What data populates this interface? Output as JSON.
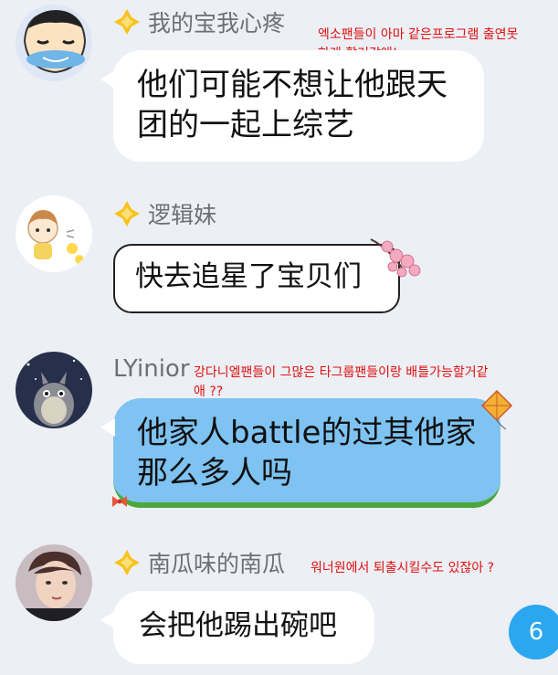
{
  "messages": [
    {
      "name": "我的宝我心疼",
      "text_line1": "他们可能不想让他跟天",
      "text_line2": "团的一起上综艺",
      "annotation_line1": "엑소팬들이 아마 같은프로그램 출연못",
      "annotation_line2": "하게 할거같애!"
    },
    {
      "name": "逻辑妹",
      "text": "快去追星了宝贝们"
    },
    {
      "name": "LYinior",
      "text_line1": "他家人battle的过其他家",
      "text_line2": "那么多人吗",
      "annotation_line1": "강다니엘팬들이 그많은 타그룹팬들이랑 배틀가능할거같",
      "annotation_line2": "애 ??"
    },
    {
      "name": "南瓜味的南瓜",
      "text": "会把他踢出碗吧",
      "annotation": "워너원에서 퇴출시킬수도 있잖아 ?"
    }
  ],
  "unread_count": "6",
  "colors": {
    "background": "#eceff4",
    "bubble": "#ffffff",
    "blue_bubble": "#7ec3f2",
    "annotation": "#e10f0f",
    "badge": "#2aa7ee",
    "name": "#6d6f73"
  },
  "icons": [
    "diamond-badge-icon",
    "kite-icon",
    "blossom-icon"
  ]
}
